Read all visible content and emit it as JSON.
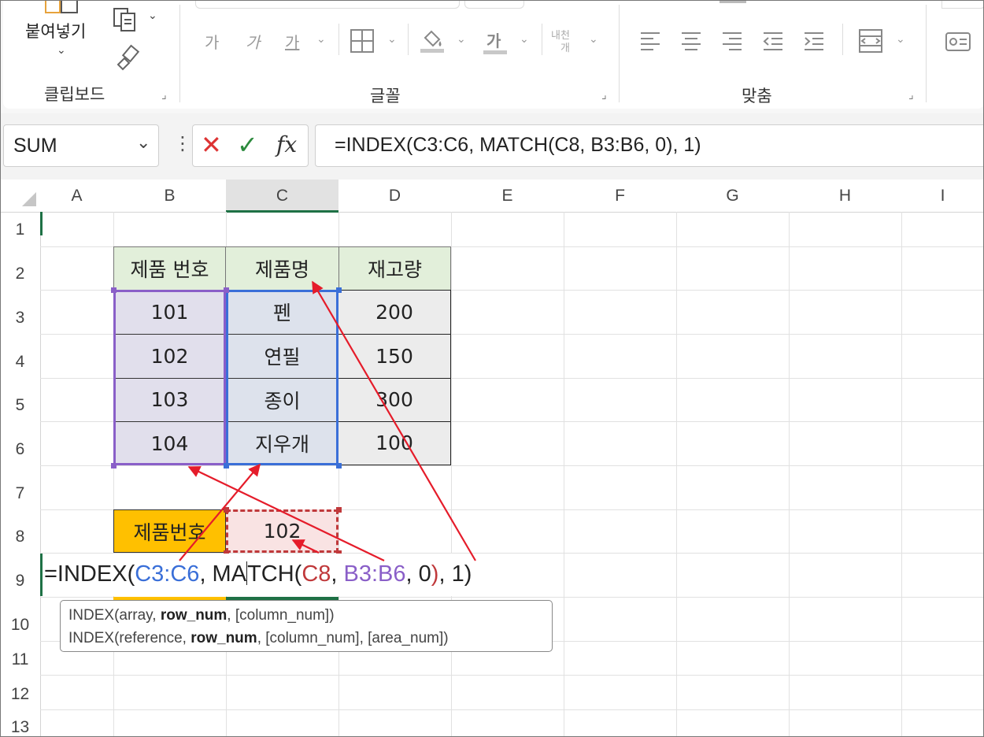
{
  "ribbon": {
    "clipboard": {
      "paste_label": "붙여넣기",
      "group_label": "클립보드"
    },
    "font": {
      "group_label": "글꼴",
      "font_sample_1": "가",
      "font_sample_2": "가",
      "underline_sample": "가",
      "font_color_sample": "가",
      "wrap_line1": "내천",
      "wrap_line2": "개"
    },
    "align": {
      "group_label": "맞춤"
    }
  },
  "formula_bar": {
    "name_box": "SUM",
    "formula": "=INDEX(C3:C6, MATCH(C8, B3:B6, 0), 1)",
    "cancel_symbol": "✕",
    "enter_symbol": "✓",
    "fx_label": "fx"
  },
  "columns": [
    "A",
    "B",
    "C",
    "D",
    "E",
    "F",
    "G",
    "H",
    "I"
  ],
  "rows": [
    "1",
    "2",
    "3",
    "4",
    "5",
    "6",
    "7",
    "8",
    "9",
    "10",
    "11",
    "12",
    "13"
  ],
  "table": {
    "headers": [
      "제품 번호",
      "제품명",
      "재고량"
    ],
    "rows": [
      [
        "101",
        "펜",
        "200"
      ],
      [
        "102",
        "연필",
        "150"
      ],
      [
        "103",
        "종이",
        "300"
      ],
      [
        "104",
        "지우개",
        "100"
      ]
    ]
  },
  "lookup": {
    "label": "제품번호",
    "value": "102"
  },
  "edit_formula": {
    "p1": "=INDEX(",
    "p2": "C3:C6",
    "p3": ", MA",
    "p4": "TCH(",
    "p5": "C8",
    "p6": ", ",
    "p7": "B3:B6",
    "p8": ", 0",
    "p9": ")",
    "p10": ", 1)"
  },
  "tooltip": {
    "line1_a": "INDEX(array, ",
    "line1_b": "row_num",
    "line1_c": ", [column_num])",
    "line2_a": "INDEX(reference, ",
    "line2_b": "row_num",
    "line2_c": ", [column_num], [area_num])"
  },
  "colors": {
    "header_fill": "#e2efda",
    "table_fill": "#ececec",
    "lookup_label_fill": "#ffc000",
    "lookup_value_fill": "#f9e3e3",
    "ref_blue": "#3a6fd8",
    "ref_purple": "#8a5fc8",
    "ref_red": "#c0393b",
    "arrow_red": "#e51c2a",
    "excel_green": "#1e7145"
  }
}
